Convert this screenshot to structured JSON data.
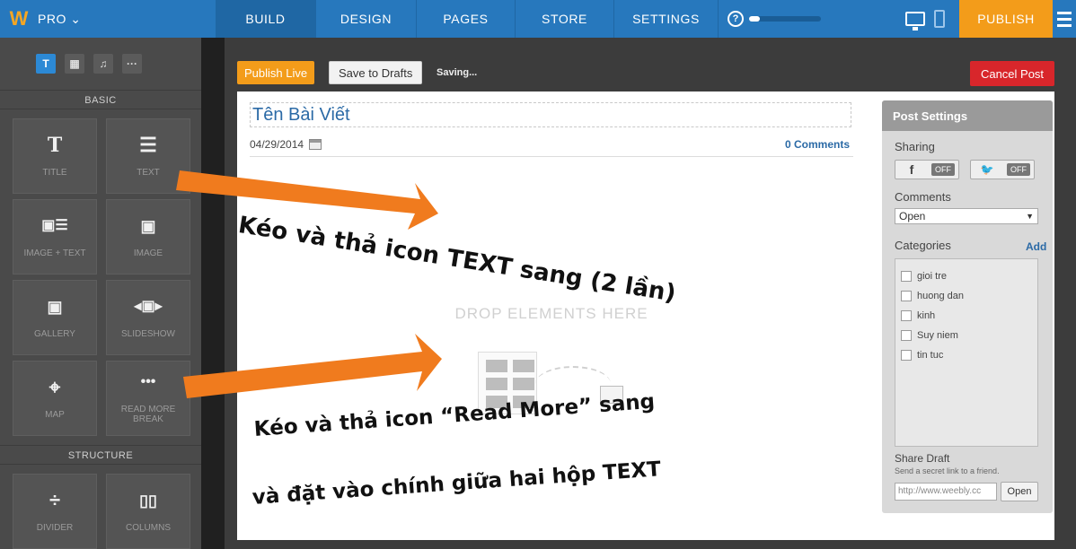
{
  "topbar": {
    "pro_label": "PRO ⌄",
    "nav": [
      {
        "label": "BUILD",
        "active": true
      },
      {
        "label": "DESIGN"
      },
      {
        "label": "PAGES"
      },
      {
        "label": "STORE"
      },
      {
        "label": "SETTINGS"
      }
    ],
    "help_glyph": "?",
    "progress": 0.15,
    "publish_label": "PUBLISH"
  },
  "sidebar": {
    "tabs": [
      "T",
      "▦",
      "♫",
      "···"
    ],
    "basic_label": "BASIC",
    "structure_label": "STRUCTURE",
    "tiles": [
      {
        "glyph": "T",
        "label": "TITLE"
      },
      {
        "glyph": "☰",
        "label": "TEXT"
      },
      {
        "glyph": "▣☰",
        "label": "IMAGE + TEXT"
      },
      {
        "glyph": "▣",
        "label": "IMAGE"
      },
      {
        "glyph": "▣",
        "label": "GALLERY"
      },
      {
        "glyph": "◂▣▸",
        "label": "SLIDESHOW"
      },
      {
        "glyph": "⌖",
        "label": "MAP"
      },
      {
        "glyph": "•••",
        "label": "READ MORE BREAK"
      }
    ],
    "structure_tiles": [
      {
        "glyph": "÷",
        "label": "DIVIDER"
      },
      {
        "glyph": "▯▯",
        "label": "COLUMNS"
      }
    ]
  },
  "toolbar": {
    "publish_live": "Publish Live",
    "save_drafts": "Save to Drafts",
    "saving": "Saving...",
    "cancel_post": "Cancel Post"
  },
  "post": {
    "title": "Tên Bài Viết",
    "date": "04/29/2014",
    "comments": "0 Comments",
    "drop_text": "DROP ELEMENTS HERE"
  },
  "settings": {
    "heading": "Post Settings",
    "sharing": "Sharing",
    "facebook_symbol": "f",
    "twitter_symbol": "🐦",
    "off": "OFF",
    "comments_label": "Comments",
    "comments_value": "Open",
    "categories_label": "Categories",
    "add": "Add",
    "categories": [
      "gioi tre",
      "huong dan",
      "kinh",
      "Suy niem",
      "tin tuc"
    ],
    "share_draft": "Share Draft",
    "share_desc": "Send a secret link to a friend.",
    "draft_link": "http://www.weebly.cc",
    "open": "Open"
  },
  "annotations": {
    "line1": "Kéo và thả icon TEXT sang (2 lần)",
    "line2": "Kéo và thả icon “Read More” sang",
    "line3": "và đặt vào chính giữa hai hộp TEXT",
    "arrow_color": "#f07b1e"
  }
}
